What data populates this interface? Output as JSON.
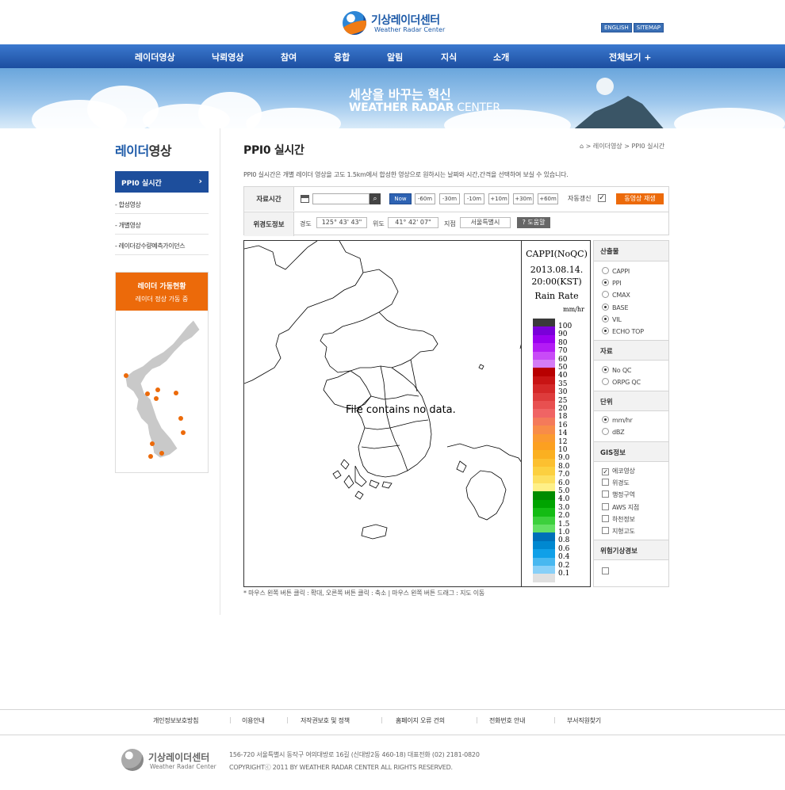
{
  "header": {
    "logo_ko": "기상레이더센터",
    "logo_en": "Weather Radar Center",
    "links": [
      "ENGLISH",
      "SITEMAP"
    ]
  },
  "gnb": {
    "items": [
      "레이더영상",
      "낙뢰영상",
      "참여",
      "융합",
      "알림",
      "지식",
      "소개"
    ],
    "all_menu": "전체보기 +"
  },
  "banner": {
    "slogan_ko": "세상을 바꾸는 혁신",
    "slogan_en_bold": "WEATHER RADAR",
    "slogan_en_rest": " CENTER"
  },
  "left": {
    "title_hl": "레이더",
    "title_rest": "영상",
    "active_item": "PPI0 실시간",
    "items": [
      "- 합성영상",
      "- 개별영상",
      "- 레이더강수량예측가이던스"
    ],
    "status_title": "레이더 가동현황",
    "status_sub": "레이더 정상 가동 중"
  },
  "content": {
    "page_title": "PPI0 실시간",
    "breadcrumb": "⌂ > 레이더영상 > PPI0 실시간",
    "description": "PPI0 실시간은 개별 레이더 영상을 고도 1.5km에서 합성한 영상으로 원하시는 날짜와 시간,간격을 선택하여 보실 수 있습니다.",
    "controls": {
      "time_label": "자료시간",
      "date_value": "",
      "time_buttons": [
        "Now",
        "-60m",
        "-30m",
        "-10m",
        "+10m",
        "+30m",
        "+60m"
      ],
      "auto_label": "자동갱신",
      "auto_checked": "✓",
      "play_label": "동영상 재생",
      "pos_label": "위경도정보",
      "lon_label": "경도",
      "lon_value": "125° 43' 43\"",
      "lat_label": "위도",
      "lat_value": "41° 42' 07\"",
      "site_label": "지점",
      "site_value": "서울특별시",
      "help_label": "? 도움말"
    },
    "map": {
      "no_data": "File contains no data."
    },
    "legend": {
      "product": "CAPPI(NoQC)",
      "date": "2013.08.14.",
      "time": "20:00(KST)",
      "title": "Rain Rate",
      "unit": "mm/hr",
      "levels": [
        "100",
        "90",
        "80",
        "70",
        "60",
        "50",
        "40",
        "35",
        "30",
        "25",
        "20",
        "18",
        "16",
        "14",
        "12",
        "10",
        "9.0",
        "8.0",
        "7.0",
        "6.0",
        "5.0",
        "4.0",
        "3.0",
        "2.0",
        "1.5",
        "1.0",
        "0.8",
        "0.6",
        "0.4",
        "0.2",
        "0.1"
      ],
      "colors": [
        "#3a3a3a",
        "#7a00d9",
        "#9a00f0",
        "#b31cf5",
        "#c84bf7",
        "#d47cf5",
        "#b80000",
        "#c81414",
        "#d42828",
        "#de3c3c",
        "#e85050",
        "#f06464",
        "#f47a5a",
        "#f88c48",
        "#fb9a30",
        "#fca020",
        "#fbb020",
        "#fcc030",
        "#fcd040",
        "#fde060",
        "#fef088",
        "#008c00",
        "#00a400",
        "#14bc14",
        "#3cd03c",
        "#64e064",
        "#0070b8",
        "#0088d0",
        "#10a0e8",
        "#48b8f0",
        "#88d0f8",
        "#e0e0e0"
      ]
    },
    "side": {
      "products_head": "산출물",
      "products": [
        {
          "label": "CAPPI",
          "on": false
        },
        {
          "label": "PPI",
          "on": true
        },
        {
          "label": "CMAX",
          "on": false
        },
        {
          "label": "BASE",
          "on": true
        },
        {
          "label": "VIL",
          "on": true
        },
        {
          "label": "ECHO TOP",
          "on": true
        }
      ],
      "data_head": "자료",
      "data": [
        {
          "label": "No QC",
          "on": true
        },
        {
          "label": "ORPG QC",
          "on": false
        }
      ],
      "unit_head": "단위",
      "units": [
        {
          "label": "mm/hr",
          "on": true
        },
        {
          "label": "dBZ",
          "on": false
        }
      ],
      "gis_head": "GIS정보",
      "gis": [
        {
          "label": "에코영상",
          "on": true
        },
        {
          "label": "위경도",
          "on": false
        },
        {
          "label": "행정구역",
          "on": false
        },
        {
          "label": "AWS 지점",
          "on": false
        },
        {
          "label": "하천정보",
          "on": false
        },
        {
          "label": "지형고도",
          "on": false
        }
      ],
      "warn_head": "위험기상경보"
    },
    "hint": "* 마우스 왼쪽 버튼 클릭 : 확대, 오른쪽 버튼 클릭 : 축소 | 마우스 왼쪽 버튼 드래그 : 지도 이동"
  },
  "footer": {
    "links": [
      "개인정보보호방침",
      "이용안내",
      "저작권보호 및 정책",
      "홈페이지 오류 건의",
      "전화번호 안내",
      "부서직원찾기"
    ],
    "logo_ko": "기상레이더센터",
    "logo_en": "Weather Radar Center",
    "address": "156-720 서울특별시 동작구 여의대방로 16길 (신대방2동 460-18) 대표전화 (02) 2181-0820",
    "copyright": "COPYRIGHTⓒ 2011 BY WEATHER RADAR CENTER ALL RIGHTS RESERVED."
  },
  "colors": {
    "nav_blue": "#1d4e9c",
    "accent_orange": "#ec6a0a"
  }
}
